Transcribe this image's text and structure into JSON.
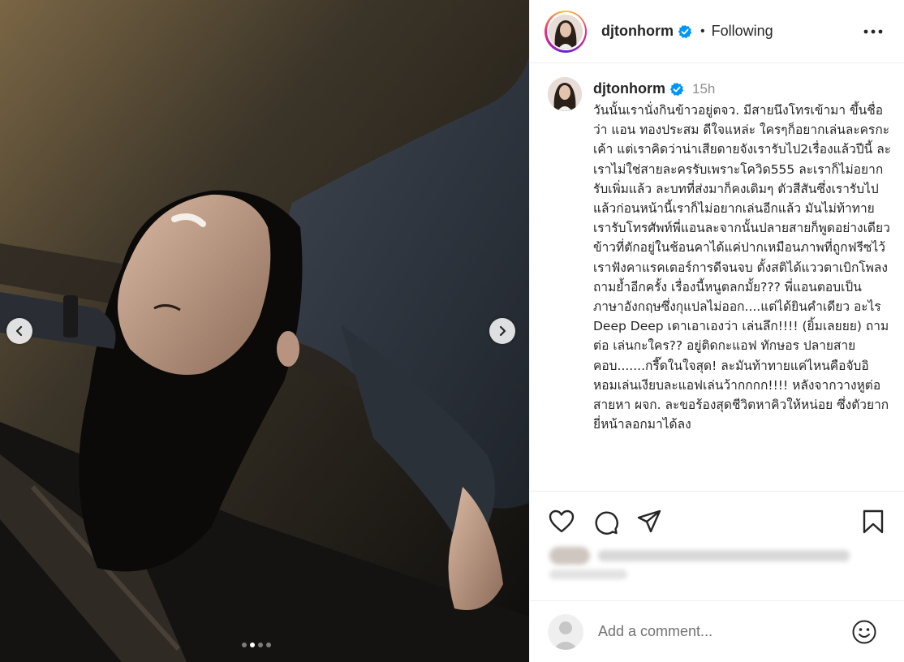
{
  "post": {
    "username": "djtonhorm",
    "follow_status": "Following",
    "separator": "•",
    "timestamp": "15h",
    "caption": "วันนั้นเรานั่งกินข้าวอยู่ตจว. มีสายนึงโทรเข้ามา ขึ้นชื่อว่า แอน ทองประสม ดีใจแหล่ะ ใครๆก็อยากเล่นละครกะเค้า แต่เราคิดว่าน่าเสียดายจังเรารับไป2เรื่องแล้วปีนี้ ละเราไม่ใช่สายละครรับเพราะโควิด555 ละเราก็ไม่อยากรับเพิ่มแล้ว ละบทที่ส่งมาก็คงเดิมๆ ตัวสีสันซึ่งเรารับไปแล้วก่อนหน้านี้เราก็ไม่อยากเล่นอีกแล้ว มันไม่ท้าทาย เรารับโทรศัพท์พี่แอนละจากนั้นปลายสายก็พูดอย่างเดียว ข้าวที่ตักอยู่ในช้อนคาได้แค่ปากเหมือนภาพที่ถูกฟรีซไว้ เราฟังคาแรคเตอร์การดีจนจบ ตั้งสติได้แววตาเบิกโพลงถามย้ำอีกครั้ง เรื่องนี้หนูตลกมั้ย??? พี่แอนตอบเป็นภาษาอังกฤษซึ่งกุแปลไม่ออก....แต่ได้ยินคำเดียว อะไร Deep Deep เดาเอาเองว่า เล่นลึก!!!! (ยิ้มเลยยย) ถามต่อ เล่นกะใคร?? อยู่ติดกะแอฟ ทักษอร ปลายสายคอบ.......กรี๊ดในใจสุด! ละมันท้าทายแค่ไหนคือจับอิหอมเล่นเงียบละแอฟเล่นว้ากกกก!!!! หลังจากวางหูต่อสายหา ผจก. ละขอร้องสุดชีวิตหาคิวให้หน่อย ซึ่งตัวยาก ยี่หน้าลอกมาได้ลง"
  },
  "comment": {
    "placeholder": "Add a comment..."
  },
  "carousel": {
    "slide_count": 4,
    "active_index": 1
  },
  "colors": {
    "verified": "#0095f6",
    "text": "#262626",
    "muted": "#8e8e8e",
    "border": "#efefef"
  },
  "icons": {
    "like": "heart-icon",
    "comment": "comment-icon",
    "share": "share-icon",
    "save": "bookmark-icon",
    "more": "more-options-icon",
    "emoji": "emoji-icon",
    "prev": "chevron-left-icon",
    "next": "chevron-right-icon"
  }
}
